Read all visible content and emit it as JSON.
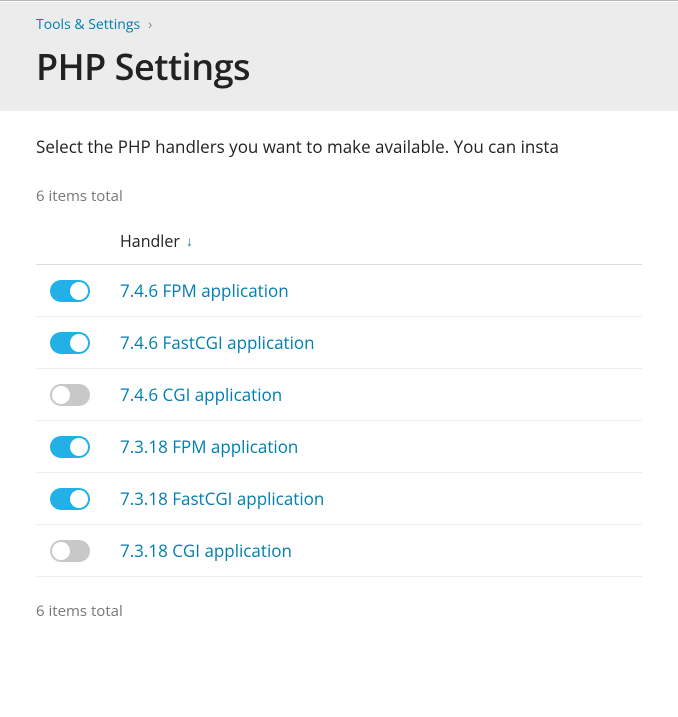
{
  "breadcrumb": {
    "parent": "Tools & Settings"
  },
  "page_title": "PHP Settings",
  "description": "Select the PHP handlers you want to make available. You can insta",
  "items_total_top": "6 items total",
  "items_total_bottom": "6 items total",
  "table": {
    "header_handler": "Handler",
    "rows": [
      {
        "enabled": true,
        "label": "7.4.6 FPM application"
      },
      {
        "enabled": true,
        "label": "7.4.6 FastCGI application"
      },
      {
        "enabled": false,
        "label": "7.4.6 CGI application"
      },
      {
        "enabled": true,
        "label": "7.3.18 FPM application"
      },
      {
        "enabled": true,
        "label": "7.3.18 FastCGI application"
      },
      {
        "enabled": false,
        "label": "7.3.18 CGI application"
      }
    ]
  }
}
